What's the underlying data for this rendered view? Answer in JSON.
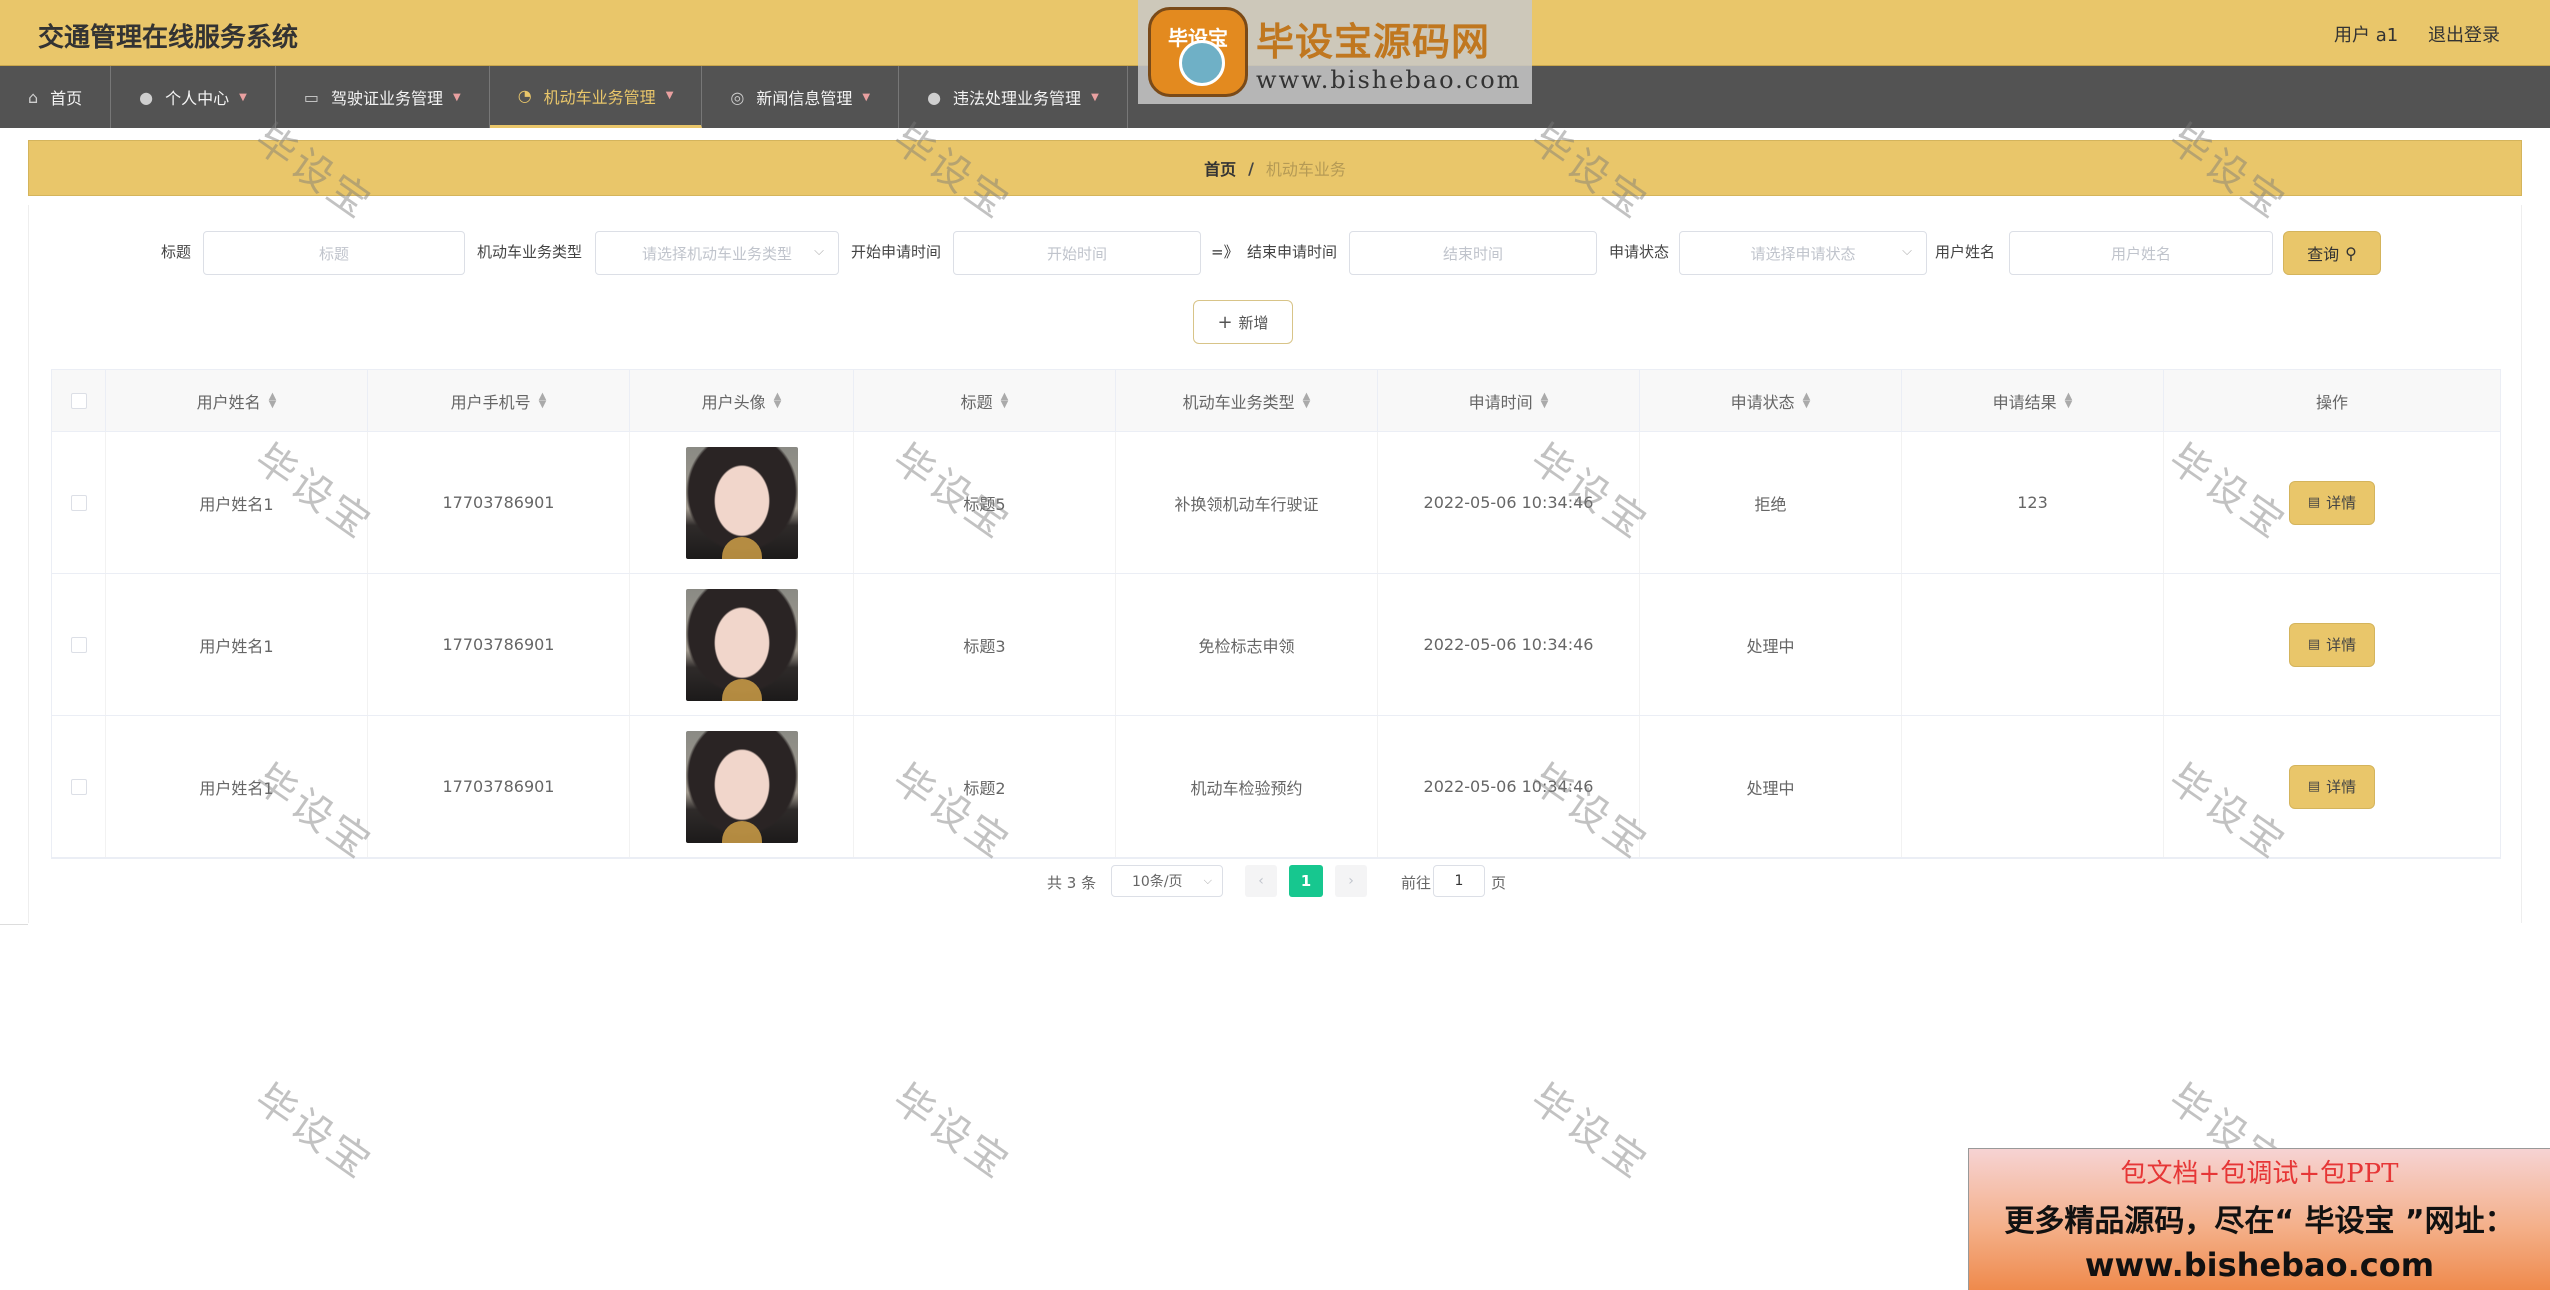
{
  "app": {
    "title": "交通管理在线服务系统"
  },
  "user": {
    "name_label": "用户 a1",
    "logout_label": "退出登录"
  },
  "nav": {
    "items": [
      {
        "label": "首页",
        "icon": "home-icon"
      },
      {
        "label": "个人中心",
        "icon": "user-icon"
      },
      {
        "label": "驾驶证业务管理",
        "icon": "card-icon"
      },
      {
        "label": "机动车业务管理",
        "icon": "gauge-icon",
        "active": true
      },
      {
        "label": "新闻信息管理",
        "icon": "globe-icon"
      },
      {
        "label": "违法处理业务管理",
        "icon": "user-icon"
      }
    ]
  },
  "breadcrumb": {
    "home": "首页",
    "separator": "/",
    "current": "机动车业务"
  },
  "filters": {
    "title_label": "标题",
    "title_placeholder": "标题",
    "type_label": "机动车业务类型",
    "type_placeholder": "请选择机动车业务类型",
    "start_label": "开始申请时间",
    "start_placeholder": "开始时间",
    "range_sep": "=》",
    "end_label": "结束申请时间",
    "end_placeholder": "结束时间",
    "status_label": "申请状态",
    "status_placeholder": "请选择申请状态",
    "username_label": "用户姓名",
    "username_placeholder": "用户姓名",
    "query_label": "查询"
  },
  "actions": {
    "add_label": "新增"
  },
  "table": {
    "columns": [
      "用户姓名",
      "用户手机号",
      "用户头像",
      "标题",
      "机动车业务类型",
      "申请时间",
      "申请状态",
      "申请结果",
      "操作"
    ],
    "rows": [
      {
        "username": "用户姓名1",
        "phone": "17703786901",
        "title": "标题5",
        "type": "补换领机动车行驶证",
        "time": "2022-05-06 10:34:46",
        "status": "拒绝",
        "result": "123",
        "action": "详情"
      },
      {
        "username": "用户姓名1",
        "phone": "17703786901",
        "title": "标题3",
        "type": "免检标志申领",
        "time": "2022-05-06 10:34:46",
        "status": "处理中",
        "result": "",
        "action": "详情"
      },
      {
        "username": "用户姓名1",
        "phone": "17703786901",
        "title": "标题2",
        "type": "机动车检验预约",
        "time": "2022-05-06 10:34:46",
        "status": "处理中",
        "result": "",
        "action": "详情"
      }
    ]
  },
  "pagination": {
    "total": "共 3 条",
    "page_size": "10条/页",
    "current_page": "1",
    "goto_label": "前往",
    "goto_value": "1",
    "page_unit": "页"
  },
  "brand": {
    "logo_text": "毕设宝",
    "name": "毕设宝源码网",
    "url": "www.bishebao.com"
  },
  "watermark": {
    "text": "毕设宝"
  },
  "promo": {
    "line1": "包文档+包调试+包PPT",
    "line2": "更多精品源码，尽在“ 毕设宝 ”网址：",
    "line3": "www.bishebao.com"
  },
  "colors": {
    "header": "#e9c66a",
    "nav": "#535353",
    "accent": "#17c78f"
  }
}
